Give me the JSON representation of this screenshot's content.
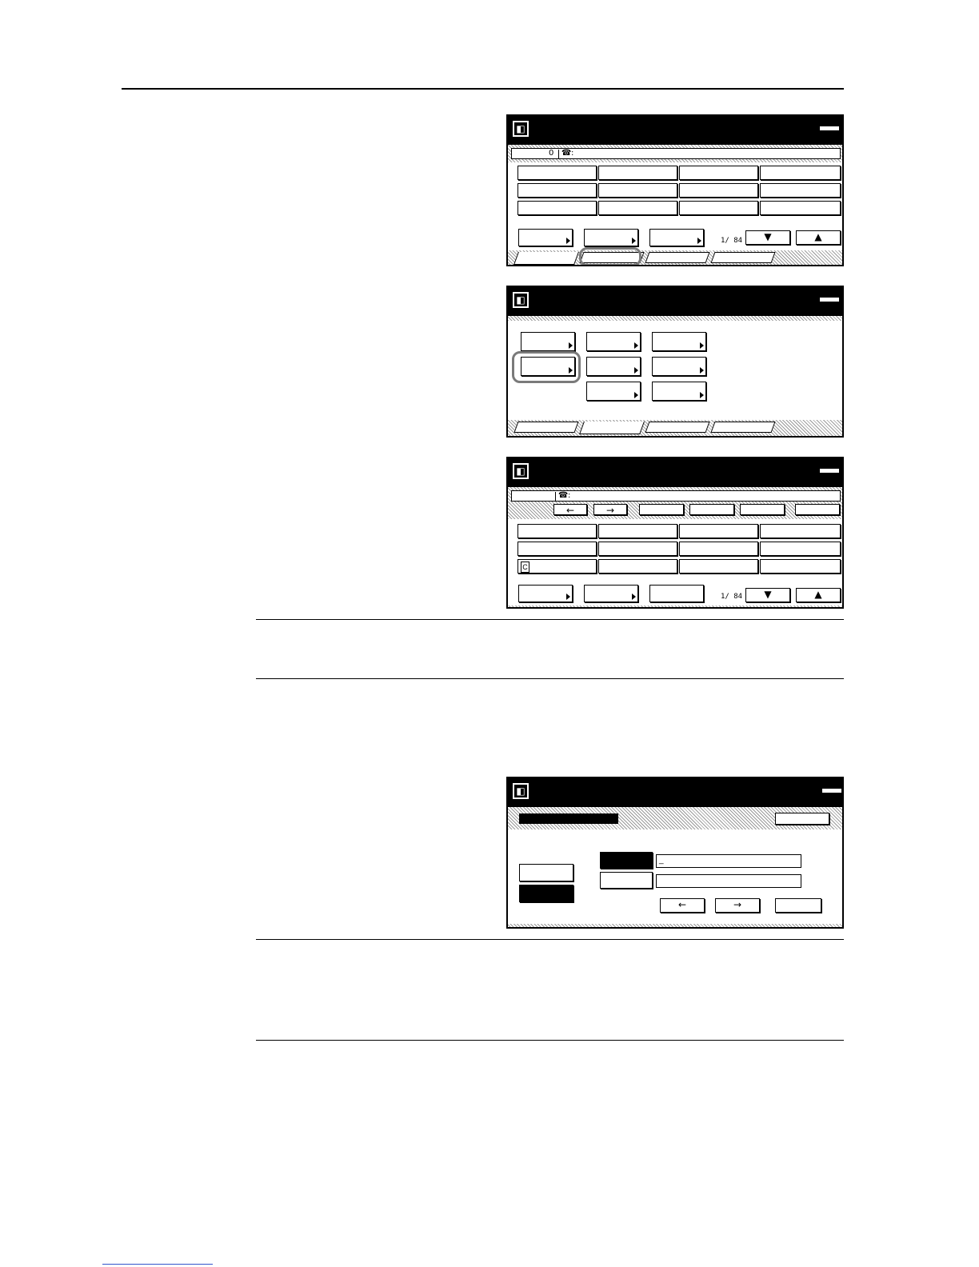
{
  "panels": {
    "p1": {
      "page_counter": "1/ 84",
      "status_digit": "0",
      "phone_glyph": "☎",
      "phone_sep": ":",
      "down_glyph": "▼",
      "up_glyph": "▲"
    },
    "p3": {
      "page_counter": "1/ 84",
      "phone_glyph": "☎",
      "phone_sep": ":",
      "left_glyph": "←",
      "right_glyph": "→",
      "down_glyph": "▼",
      "up_glyph": "▲",
      "row_marker": "C"
    },
    "p4": {
      "cursor": "_",
      "left_glyph": "←",
      "right_glyph": "→"
    }
  },
  "colors": {
    "screen_black": "#000000",
    "highlight_gray": "#7a7a7a",
    "link_blue": "#3355cc"
  }
}
